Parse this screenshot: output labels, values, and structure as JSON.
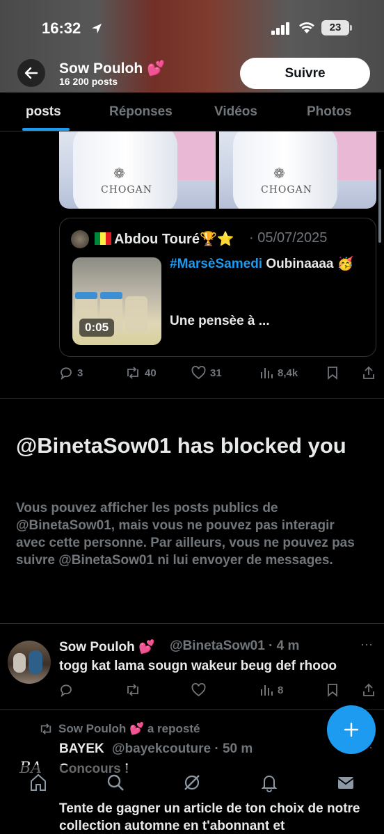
{
  "status_bar": {
    "time": "16:32",
    "battery": "23"
  },
  "profile": {
    "name": "Sow Pouloh 💕",
    "post_count": "16 200 posts",
    "follow_label": "Suivre"
  },
  "tabs": [
    {
      "label": "posts",
      "active": true
    },
    {
      "label": "Réponses",
      "active": false
    },
    {
      "label": "Vidéos",
      "active": false
    },
    {
      "label": "Photos",
      "active": false
    }
  ],
  "media": {
    "brand": "CHOGAN"
  },
  "quote": {
    "flag": "🇸🇳",
    "name": "Abdou Touré🏆⭐",
    "date": "· 05/07/2025",
    "hashtag": "#MarsèSamedi",
    "text1": " Oubinaaaa 🥳",
    "text2": "Une pensèe à ...",
    "duration": "0:05"
  },
  "post1_actions": {
    "replies": "3",
    "reposts": "40",
    "likes": "31",
    "views": "8,4k"
  },
  "blocked": {
    "title": "@BinetaSow01 has blocked you",
    "description": "Vous pouvez afficher les posts publics de @BinetaSow01, mais vous ne pouvez pas interagir avec cette personne. Par ailleurs, vous ne pouvez pas suivre @BinetaSow01 ni lui envoyer de messages."
  },
  "post2": {
    "name": "Sow Pouloh 💕",
    "handle": "@BinetaSow01 · 4 m",
    "text": "togg kat lama sougn wakeur beug def rhooo",
    "views": "8",
    "more": "···"
  },
  "repost": {
    "reposted_by": "Sow Pouloh 💕 a reposté",
    "name": "BAYEK",
    "handle": "@bayekcouture · 50 m",
    "text1": "Concours !",
    "text2": "Tente de gagner un article de ton choix de notre collection automne en t'abonnant et",
    "avatar_text": "BA",
    "more": "···"
  },
  "colors": {
    "accent": "#1d9bf0",
    "muted": "#71767b",
    "text": "#e7e9ea",
    "background": "#000000"
  }
}
